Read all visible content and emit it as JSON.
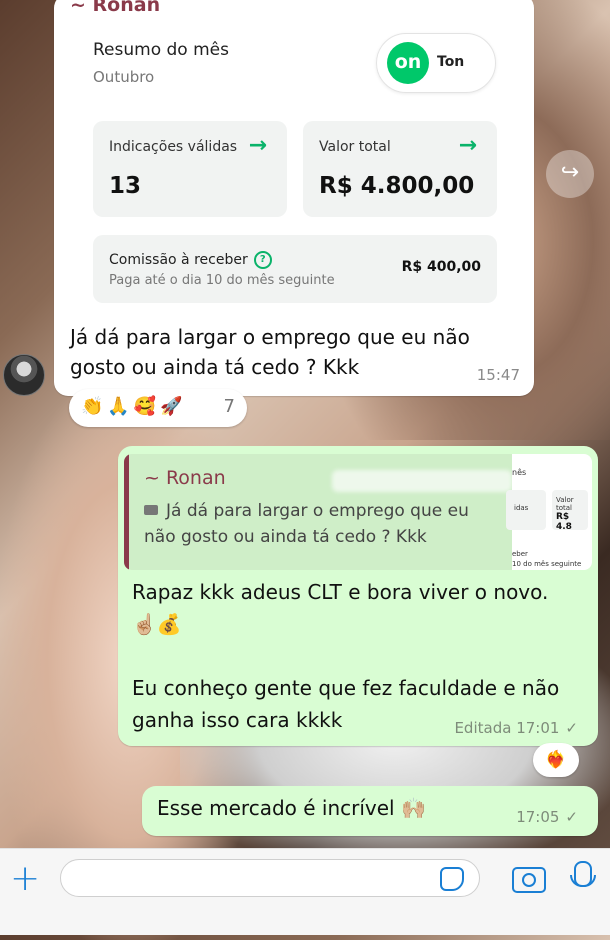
{
  "incoming": {
    "sender": "~ Ronan",
    "card": {
      "summary_title": "Resumo do mês",
      "summary_month": "Outubro",
      "brand_logo_text": "on",
      "brand_name": "Ton",
      "metrics": [
        {
          "label": "Indicações válidas",
          "value": "13",
          "arrow": "→"
        },
        {
          "label": "Valor total",
          "value": "R$ 4.800,00",
          "arrow": "→"
        }
      ],
      "commission": {
        "label": "Comissão à receber",
        "help": "?",
        "sub": "Paga até o dia 10 do mês seguinte",
        "value": "R$ 400,00"
      }
    },
    "text": "Já dá para largar o emprego que eu não gosto ou ainda tá cedo ? Kkk",
    "time": "15:47",
    "reactions": {
      "emojis": "👏🙏🥰🚀",
      "count": "7"
    }
  },
  "forward_icon": "↪",
  "outgoing_1": {
    "quote": {
      "sender": "~ Ronan",
      "text": "Já dá para largar o emprego que eu não gosto ou ainda tá cedo ? Kkk",
      "thumb": {
        "title": "nês",
        "left_label": "idas",
        "right_label": "Valor total",
        "right_value": "R$ 4.8",
        "bottom_label": "eber",
        "bottom_sub": "10 do mês seguinte"
      }
    },
    "line1": "Rapaz kkk adeus CLT e bora viver o novo. ☝🏼💰",
    "line2": "Eu conheço gente que fez faculdade e não ganha isso cara kkkk",
    "edited_label": "Editada",
    "time": "17:01",
    "check": "✓",
    "reaction": "❤️‍🔥"
  },
  "outgoing_2": {
    "text": "Esse mercado é incrível 🙌🏼",
    "time": "17:05",
    "check": "✓"
  },
  "input_bar": {
    "plus": "+",
    "placeholder": ""
  }
}
